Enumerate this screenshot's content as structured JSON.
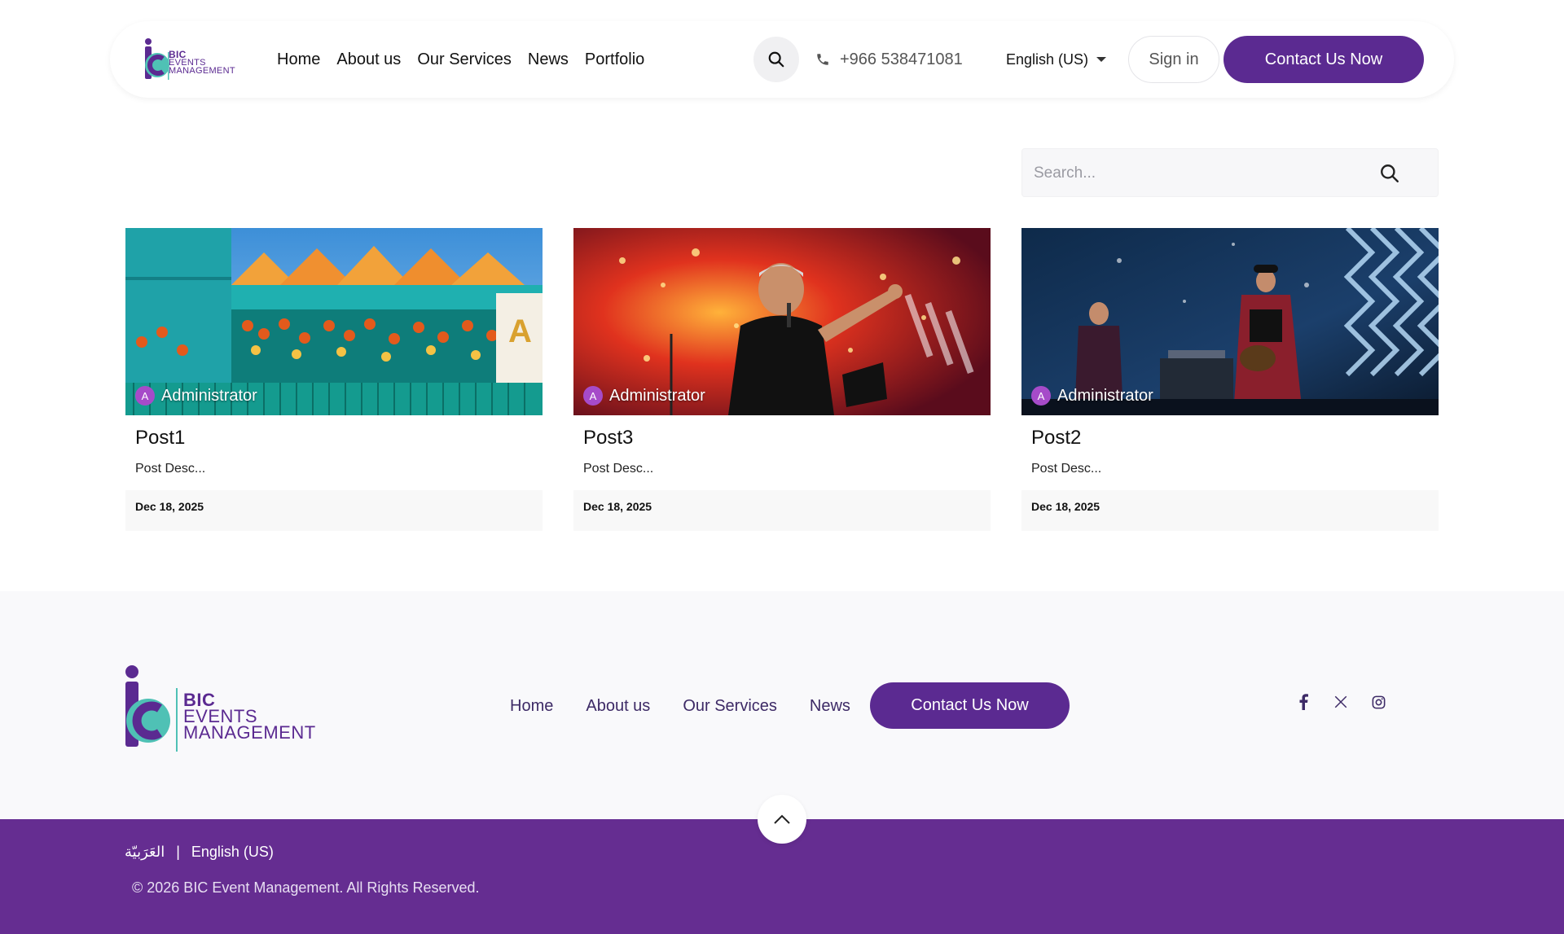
{
  "header": {
    "logo_line1": "BIC",
    "logo_line2": "EVENTS",
    "logo_line3": "MANAGEMENT",
    "nav": [
      "Home",
      "About us",
      "Our Services",
      "News",
      "Portfolio"
    ],
    "phone": "+966 538471081",
    "language": "English (US)",
    "signin_label": "Sign in",
    "contact_label": "Contact Us Now"
  },
  "search": {
    "placeholder": "Search..."
  },
  "posts": [
    {
      "author_initial": "A",
      "author": "Administrator",
      "title": "Post1",
      "desc": "Post Desc...",
      "date": "Dec 18, 2025"
    },
    {
      "author_initial": "A",
      "author": "Administrator",
      "title": "Post3",
      "desc": "Post Desc...",
      "date": "Dec 18, 2025"
    },
    {
      "author_initial": "A",
      "author": "Administrator",
      "title": "Post2",
      "desc": "Post Desc...",
      "date": "Dec 18, 2025"
    }
  ],
  "footer": {
    "logo_line1": "BIC",
    "logo_line2": "EVENTS",
    "logo_line3": "MANAGEMENT",
    "nav": [
      "Home",
      "About us",
      "Our Services",
      "News"
    ],
    "contact_label": "Contact Us Now",
    "socials": [
      "facebook-icon",
      "x-icon",
      "instagram-icon"
    ],
    "lang_ar": "العَرَبيّة",
    "separator": "|",
    "lang_en": "English (US)",
    "copyright": "© 2026 BIC Event Management. All Rights Reserved."
  },
  "colors": {
    "brand_purple": "#5b2a91",
    "footer_purple": "#652d91",
    "logo_teal": "#4fc1b5"
  }
}
